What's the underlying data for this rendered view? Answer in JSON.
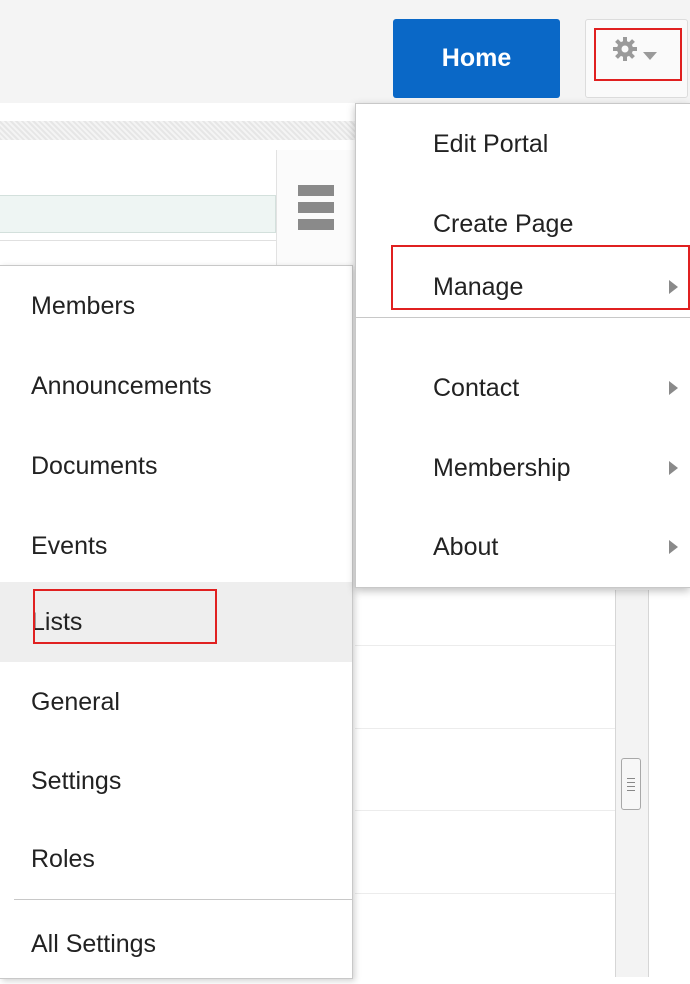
{
  "header": {
    "home_label": "Home",
    "settings_icon": "gear-icon",
    "dropdown_icon": "caret-down-icon"
  },
  "settings_menu": {
    "items": [
      {
        "label": "Edit Portal",
        "has_submenu": false
      },
      {
        "label": "Create Page",
        "has_submenu": false
      },
      {
        "label": "Manage",
        "has_submenu": true
      },
      {
        "label": "Contact",
        "has_submenu": true
      },
      {
        "label": "Membership",
        "has_submenu": true
      },
      {
        "label": "About",
        "has_submenu": true
      }
    ]
  },
  "manage_submenu": {
    "items": [
      {
        "label": "Members"
      },
      {
        "label": "Announcements"
      },
      {
        "label": "Documents"
      },
      {
        "label": "Events"
      },
      {
        "label": "Lists"
      },
      {
        "label": "General"
      },
      {
        "label": "Settings"
      },
      {
        "label": "Roles"
      },
      {
        "label": "All Settings"
      }
    ]
  },
  "colors": {
    "primary": "#0a68c7",
    "highlight": "#e02020",
    "hover": "#eeeeee"
  }
}
